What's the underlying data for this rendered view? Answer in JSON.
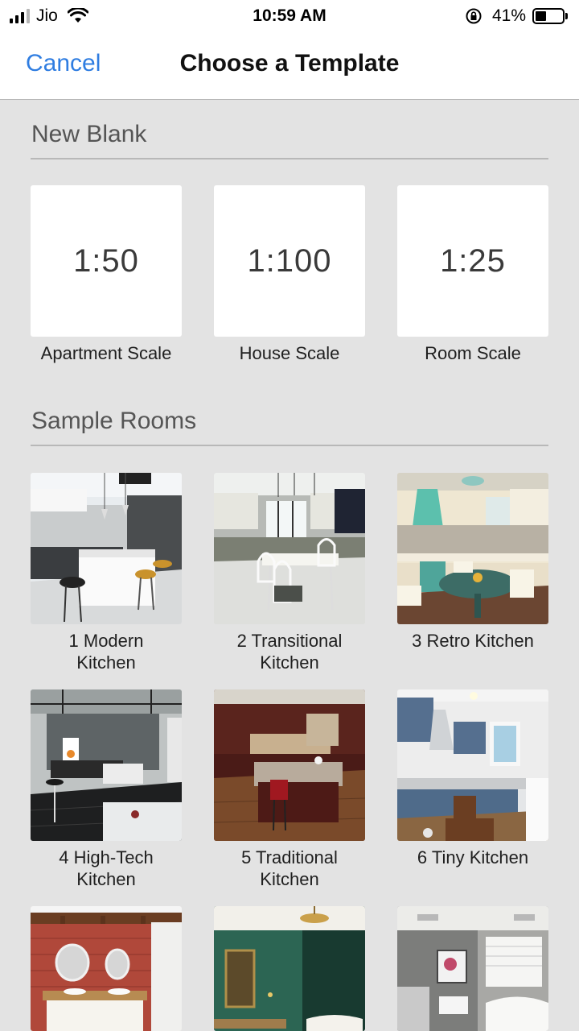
{
  "status_bar": {
    "carrier": "Jio",
    "time": "10:59 AM",
    "battery_percent": "41%",
    "battery_level": 0.41,
    "icons": [
      "cellular-signal-icon",
      "wifi-icon",
      "rotation-lock-icon",
      "battery-icon"
    ]
  },
  "nav": {
    "cancel_label": "Cancel",
    "title": "Choose a Template"
  },
  "new_blank": {
    "header": "New Blank",
    "items": [
      {
        "scale": "1:50",
        "label": "Apartment Scale"
      },
      {
        "scale": "1:100",
        "label": "House Scale"
      },
      {
        "scale": "1:25",
        "label": "Room Scale"
      }
    ]
  },
  "sample_rooms": {
    "header": "Sample Rooms",
    "items": [
      {
        "line1": "1 Modern",
        "line2": "Kitchen"
      },
      {
        "line1": "2 Transitional",
        "line2": "Kitchen"
      },
      {
        "line1": "3 Retro Kitchen",
        "line2": ""
      },
      {
        "line1": "4 High-Tech",
        "line2": "Kitchen"
      },
      {
        "line1": "5 Traditional",
        "line2": "Kitchen"
      },
      {
        "line1": "6 Tiny Kitchen",
        "line2": ""
      },
      {
        "line1": "",
        "line2": ""
      },
      {
        "line1": "",
        "line2": ""
      },
      {
        "line1": "",
        "line2": ""
      }
    ]
  },
  "colors": {
    "accent": "#2f7de1",
    "background": "#e3e3e3",
    "nav_background": "#ffffff"
  }
}
